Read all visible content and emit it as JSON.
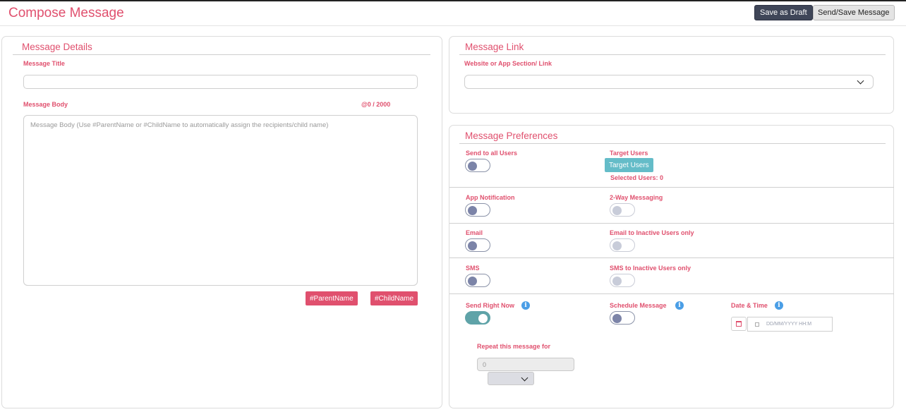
{
  "header": {
    "title": "Compose Message",
    "save_draft_label": "Save as Draft",
    "send_save_label": "Send/Save Message"
  },
  "details": {
    "title": "Message Details",
    "message_title_label": "Message Title",
    "message_title_value": "",
    "body_label": "Message Body",
    "char_counter": "@0 / 2000",
    "body_placeholder": "Message Body (Use #ParentName or #ChildName to automatically assign the recipients/child name)",
    "parent_tag_label": "#ParentName",
    "child_tag_label": "#ChildName"
  },
  "link": {
    "title": "Message Link",
    "website_label": "Website or App Section/ Link",
    "selected_value": ""
  },
  "preferences": {
    "title": "Message Preferences",
    "send_all_label": "Send to all Users",
    "send_all_on": false,
    "target_users_label": "Target Users",
    "target_users_button": "Target Users",
    "selected_users_label": "Selected Users: 0",
    "app_notification_label": "App Notification",
    "app_notification_on": false,
    "two_way_label": "2-Way Messaging",
    "two_way_on": false,
    "email_label": "Email",
    "email_on": false,
    "email_inactive_label": "Email to Inactive Users only",
    "email_inactive_on": false,
    "sms_label": "SMS",
    "sms_on": false,
    "sms_inactive_label": "SMS to Inactive Users only",
    "sms_inactive_on": false,
    "send_now_label": "Send Right Now",
    "send_now_on": true,
    "schedule_label": "Schedule Message",
    "schedule_on": false,
    "date_time_label": "Date & Time",
    "date_placeholder": "DD/MM/YYYY HH:M",
    "repeat_label": "Repeat this message for",
    "repeat_value": "0",
    "repeat_unit": ""
  },
  "colors": {
    "accent": "#e0506e",
    "draft_button": "#3f4658",
    "target_button": "#64bcc8",
    "toggle_on": "#5fa3a8",
    "info_icon": "#4a9ee6"
  }
}
